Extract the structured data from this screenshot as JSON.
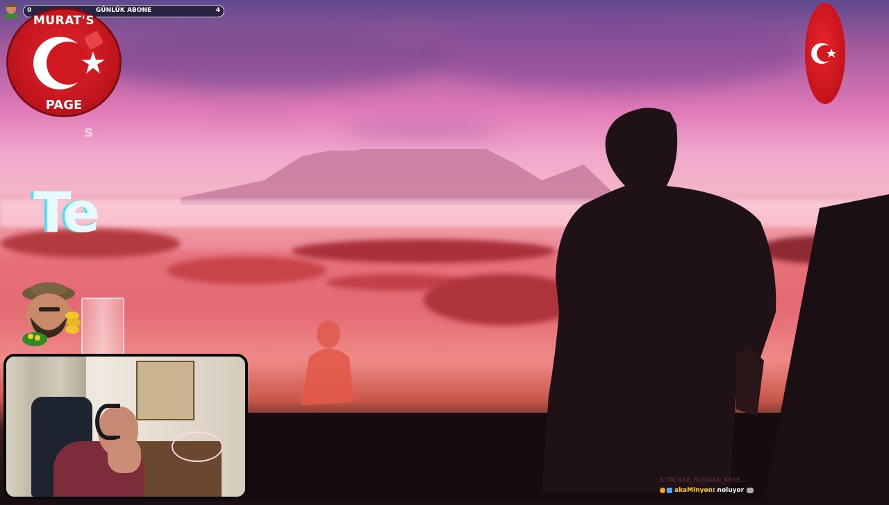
{
  "overlay": {
    "sub_goal": {
      "label": "GÜNLÜK ABONE",
      "min": "0",
      "max": "4"
    },
    "logo": {
      "top_text": "MURAT'S",
      "bottom_text": "PAGE"
    },
    "video_caption": {
      "partial_text": "Te",
      "small_letter": "s"
    }
  },
  "chat": {
    "faded_line": "S.TRCAKE_RUSSIAN_KEKE...",
    "messages": [
      {
        "username": "akaMinyon",
        "separator": ":",
        "text": "noluyor"
      }
    ]
  },
  "colors": {
    "flag_red": "#c4121a",
    "sky_pink": "#f0a8cc",
    "sea_red": "#e46a74",
    "chat_username": "#ffcc33"
  },
  "icons": {
    "logo": "turkish-crescent-star-badge",
    "flag": "turkish-flag-oval",
    "mascot": "bearded-man-cartoon-with-coins"
  }
}
